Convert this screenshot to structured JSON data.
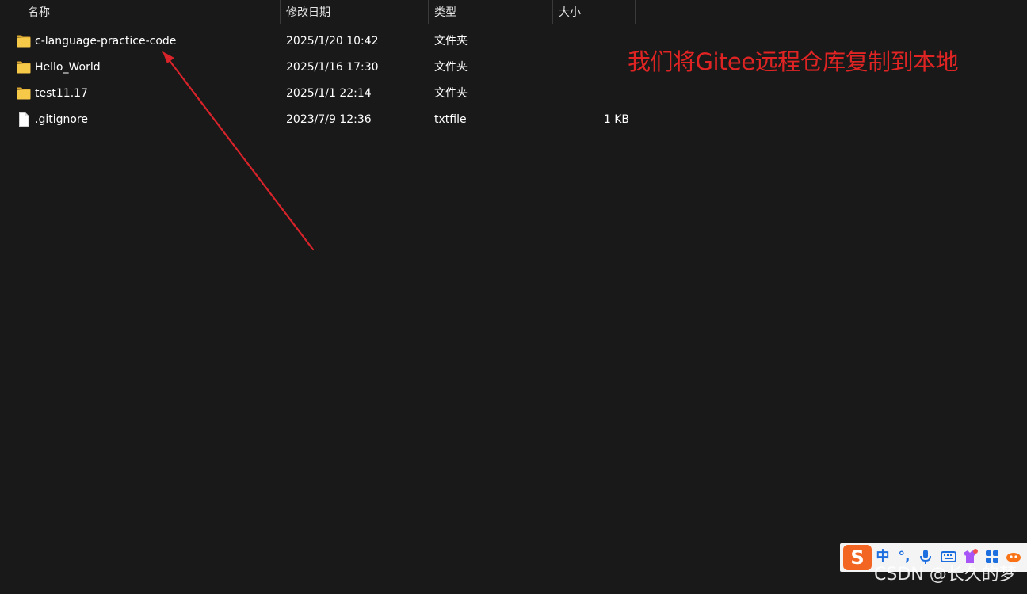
{
  "columns": {
    "name": "名称",
    "date": "修改日期",
    "type": "类型",
    "size": "大小"
  },
  "sort_indicator": "^",
  "files": [
    {
      "icon": "folder-icon",
      "name": "c-language-practice-code",
      "date": "2025/1/20 10:42",
      "type": "文件夹",
      "size": ""
    },
    {
      "icon": "folder-icon",
      "name": "Hello_World",
      "date": "2025/1/16 17:30",
      "type": "文件夹",
      "size": ""
    },
    {
      "icon": "folder-icon",
      "name": "test11.17",
      "date": "2025/1/1 22:14",
      "type": "文件夹",
      "size": ""
    },
    {
      "icon": "file-icon",
      "name": ".gitignore",
      "date": "2023/7/9 12:36",
      "type": "txtfile",
      "size": "1 KB"
    }
  ],
  "annotation": {
    "text": "我们将Gitee远程仓库复制到本地",
    "color": "#e02424"
  },
  "ime_toolbar": {
    "logo": "S",
    "mode": "中",
    "punctuation": "°,",
    "icons": [
      "sogou-logo-icon",
      "chinese-mode-icon",
      "punctuation-icon",
      "microphone-icon",
      "keyboard-icon",
      "skin-icon",
      "apps-grid-icon",
      "toolbox-icon"
    ]
  },
  "watermark": "CSDN @长久的梦",
  "colors": {
    "background": "#191919",
    "folder": "#f7c948",
    "arrow": "#d8232a",
    "ime_logo": "#f26522",
    "ime_accent": "#1d6fe0"
  }
}
